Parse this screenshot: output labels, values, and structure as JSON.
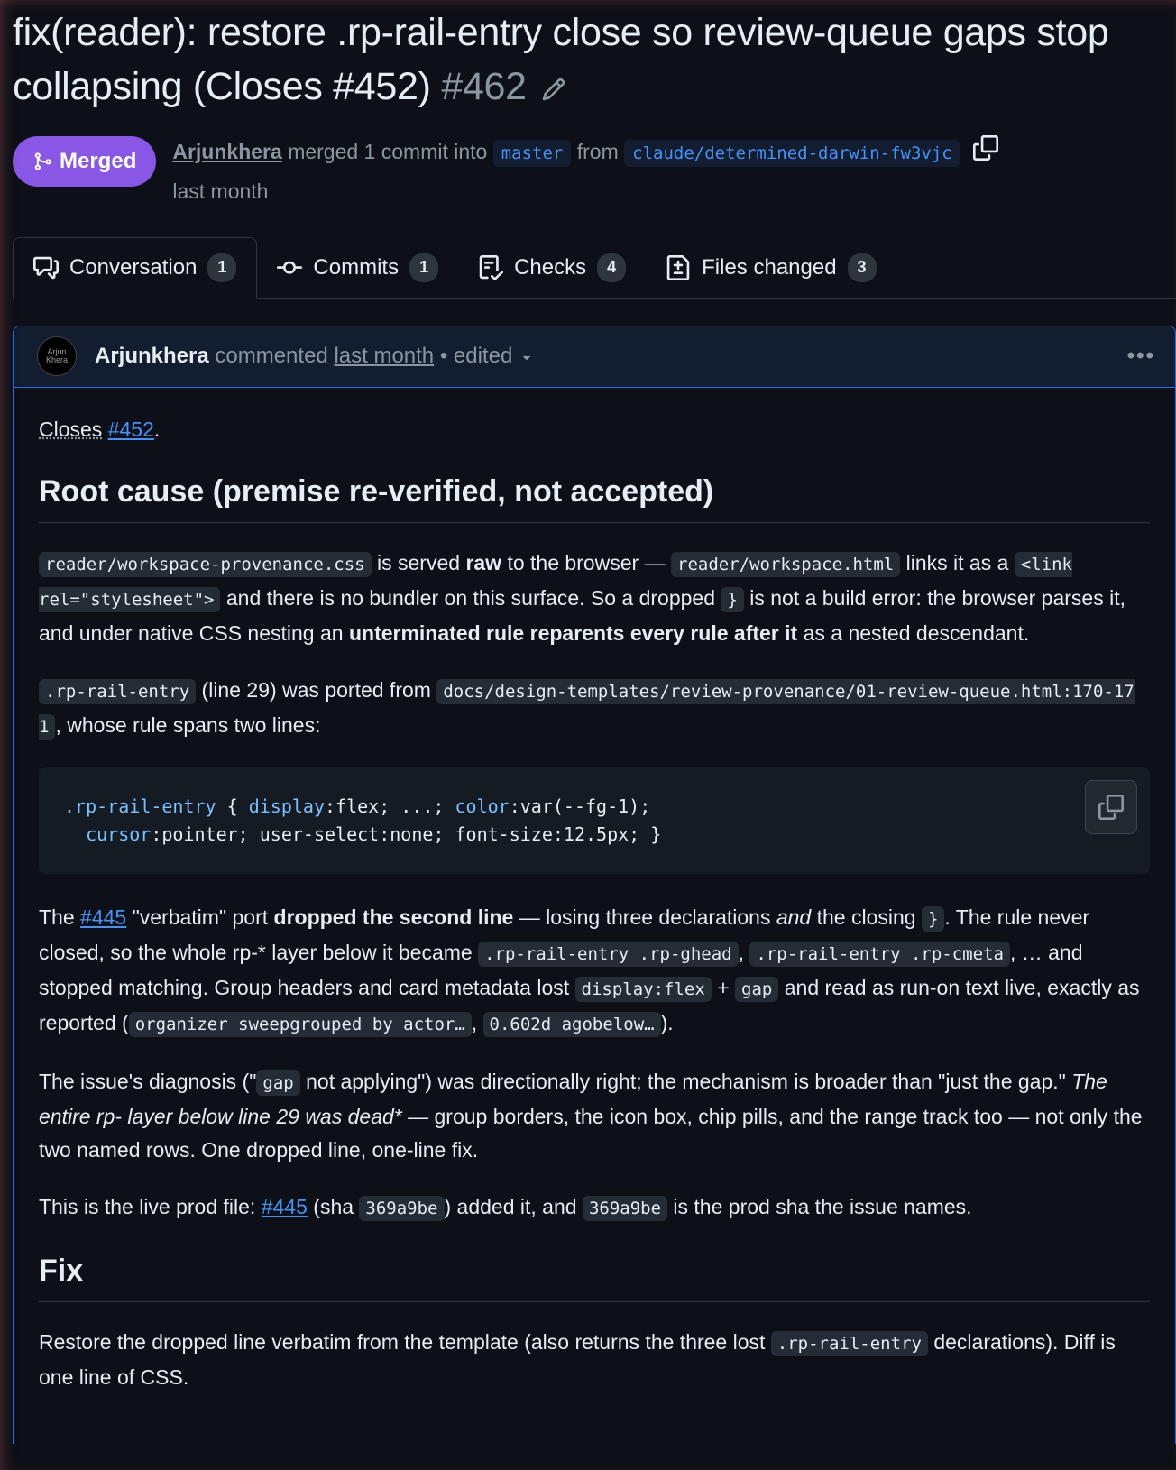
{
  "pr": {
    "title": "fix(reader): restore .rp-rail-entry close so review-queue gaps stop collapsing (Closes #452)",
    "number": "#462",
    "status": "Merged",
    "author": "Arjunkhera",
    "merged_text_1": "merged 1 commit into",
    "base_branch": "master",
    "from_text": "from",
    "head_branch": "claude/determined-darwin-fw3vjc",
    "time": "last month"
  },
  "tabs": [
    {
      "label": "Conversation",
      "count": "1",
      "icon": "comment-discussion-icon"
    },
    {
      "label": "Commits",
      "count": "1",
      "icon": "git-commit-icon"
    },
    {
      "label": "Checks",
      "count": "4",
      "icon": "checklist-icon"
    },
    {
      "label": "Files changed",
      "count": "3",
      "icon": "file-diff-icon"
    }
  ],
  "comment": {
    "avatar_text": "Arjun Khera",
    "author": "Arjunkhera",
    "action": "commented",
    "time": "last month",
    "edited": "• edited",
    "more": "•••",
    "closes_prefix": "Closes",
    "closes_link": "#452",
    "h_root": "Root cause (premise re-verified, not accepted)",
    "p1": {
      "c1": "reader/workspace-provenance.css",
      "t1": " is served ",
      "b1": "raw",
      "t2": " to the browser — ",
      "c2": "reader/workspace.html",
      "t3": " links it as a ",
      "c3": "<link rel=\"stylesheet\">",
      "t4": " and there is no bundler on this surface. So a dropped ",
      "c4": "}",
      "t5": " is not a build error: the browser parses it, and under native CSS nesting an ",
      "b2": "unterminated rule reparents every rule after it",
      "t6": " as a nested descendant."
    },
    "p2": {
      "c1": ".rp-rail-entry",
      "t1": " (line 29) was ported from ",
      "c2": "docs/design-templates/review-provenance/01-review-queue.html:170-171",
      "t2": ", whose rule spans two lines:"
    },
    "code": {
      "line1_sel": ".rp-rail-entry",
      "line1_rest_a": " { ",
      "line1_prop1": "display",
      "line1_rest_b": ":flex; ...; ",
      "line1_prop2": "color",
      "line1_rest_c": ":var(--fg-1);",
      "line2_indent": "  ",
      "line2_prop1": "cursor",
      "line2_rest": ":pointer; user-select:none; font-size:12.5px; }"
    },
    "p3": {
      "t1": "The ",
      "a1": "#445",
      "t2": " \"verbatim\" port ",
      "b1": "dropped the second line",
      "t3": " — losing three declarations ",
      "i1": "and",
      "t4": " the closing ",
      "c1": "}",
      "t5": ". The rule never closed, so the whole rp-* layer below it became ",
      "c2": ".rp-rail-entry .rp-ghead",
      "t6": ", ",
      "c3": ".rp-rail-entry .rp-cmeta",
      "t7": ", … and stopped matching. Group headers and card metadata lost ",
      "c4": "display:flex",
      "t8": " + ",
      "c5": "gap",
      "t9": " and read as run-on text live, exactly as reported (",
      "c6": "organizer sweepgrouped by actor…",
      "t10": ", ",
      "c7": "0.602d agobelow…",
      "t11": ")."
    },
    "p4": {
      "t1": "The issue's diagnosis (\"",
      "c1": "gap",
      "t2": " not applying\") was directionally right; the mechanism is broader than \"just the gap.\" ",
      "i1": "The entire rp- layer below line 29 was dead*",
      "t3": " — group borders, the icon box, chip pills, and the range track too — not only the two named rows. One dropped line, one-line fix."
    },
    "p5": {
      "t1": "This is the live prod file: ",
      "a1": "#445",
      "t2": " (sha ",
      "c1": "369a9be",
      "t3": ") added it, and ",
      "c2": "369a9be",
      "t4": " is the prod sha the issue names."
    },
    "h_fix": "Fix",
    "p6": {
      "t1": "Restore the dropped line verbatim from the template (also returns the three lost ",
      "c1": ".rp-rail-entry",
      "t2": " declarations). Diff is one line of CSS."
    }
  }
}
